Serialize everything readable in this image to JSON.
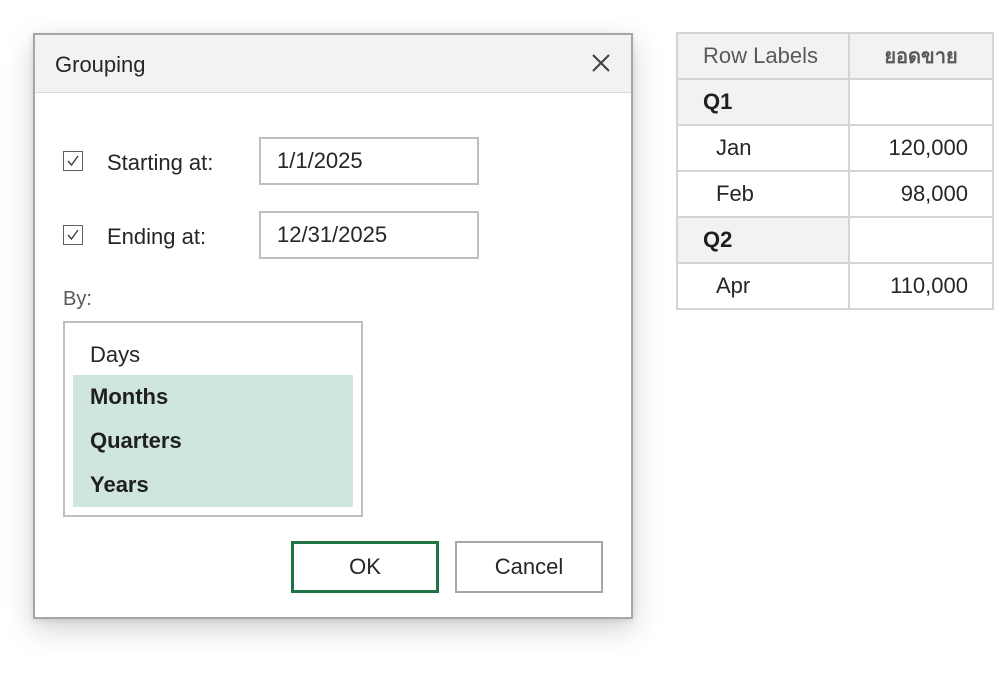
{
  "dialog": {
    "title": "Grouping",
    "starting": {
      "label": "Starting at:",
      "checked": true,
      "value": "1/1/2025"
    },
    "ending": {
      "label": "Ending at:",
      "checked": true,
      "value": "12/31/2025"
    },
    "by_label": "By:",
    "by_options": [
      {
        "label": "Days",
        "selected": false
      },
      {
        "label": "Months",
        "selected": true
      },
      {
        "label": "Quarters",
        "selected": true
      },
      {
        "label": "Years",
        "selected": true
      }
    ],
    "ok_label": "OK",
    "cancel_label": "Cancel",
    "icons": {
      "close": "close-icon",
      "check": "checkmark-icon"
    },
    "colors": {
      "accent": "#217346",
      "selection": "#cfe6dc"
    }
  },
  "pivot": {
    "headers": [
      "Row Labels",
      "ยอดขาย"
    ],
    "rows": [
      {
        "type": "group",
        "label": "Q1",
        "value": ""
      },
      {
        "type": "item",
        "label": "Jan",
        "value": "120,000"
      },
      {
        "type": "item",
        "label": "Feb",
        "value": "98,000"
      },
      {
        "type": "group",
        "label": "Q2",
        "value": ""
      },
      {
        "type": "item",
        "label": "Apr",
        "value": "110,000"
      }
    ]
  }
}
